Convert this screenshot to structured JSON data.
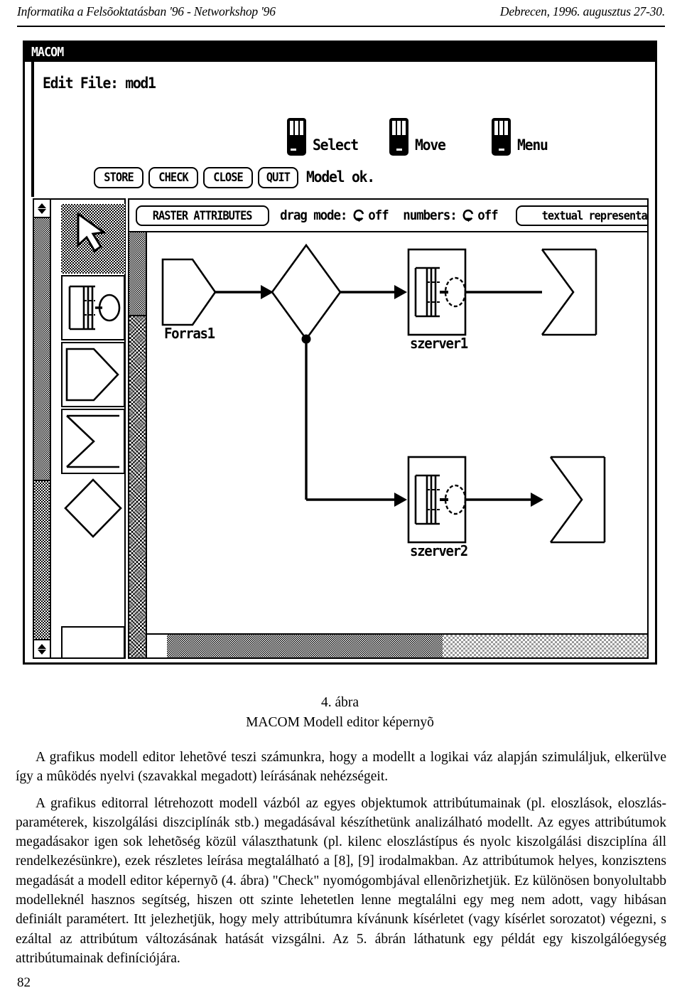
{
  "running_head": {
    "left": "Informatika a Felsõoktatásban '96 - Networkshop '96",
    "right": "Debrecen, 1996. augusztus 27-30."
  },
  "screenshot": {
    "window_title": "MACOM",
    "edit_file_line": "Edit File: mod1",
    "mouse_legend": [
      {
        "label": "Select",
        "icon": "mouse-left-button-icon",
        "active_button": 0
      },
      {
        "label": "Move",
        "icon": "mouse-middle-button-icon",
        "active_button": 1
      },
      {
        "label": "Menu",
        "icon": "mouse-right-button-icon",
        "active_button": 2
      }
    ],
    "action_buttons": [
      {
        "label": "STORE"
      },
      {
        "label": "CHECK"
      },
      {
        "label": "CLOSE"
      },
      {
        "label": "QUIT"
      }
    ],
    "status_text": "Model ok.",
    "toolbar": {
      "raster_attributes_label": "RASTER ATTRIBUTES",
      "drag_mode_label": "drag mode:",
      "drag_mode_value": "off",
      "numbers_label": "numbers:",
      "numbers_value": "off",
      "textual_representation_label": "textual representat"
    },
    "palette": {
      "items": [
        {
          "name": "arrow-cursor-tool",
          "selected": true
        },
        {
          "name": "server-tool",
          "selected": false
        },
        {
          "name": "source-pentagon-tool",
          "selected": false
        },
        {
          "name": "sink-chevron-tool",
          "selected": false
        },
        {
          "name": "router-diamond-tool",
          "selected": false
        },
        {
          "name": "rectangle-tool",
          "selected": false
        }
      ]
    },
    "diagram": {
      "nodes": [
        {
          "id": "forras1",
          "type": "source",
          "label": "Forras1"
        },
        {
          "id": "router1",
          "type": "diamond",
          "label": ""
        },
        {
          "id": "szerver1",
          "type": "server",
          "label": "szerver1"
        },
        {
          "id": "sink1",
          "type": "chevron",
          "label": ""
        },
        {
          "id": "szerver2",
          "type": "server",
          "label": "szerver2"
        },
        {
          "id": "sink2",
          "type": "chevron",
          "label": ""
        }
      ]
    }
  },
  "caption": {
    "figure_number": "4. ábra",
    "figure_title": "MACOM Modell editor képernyõ"
  },
  "body": {
    "paragraphs": [
      "A grafikus modell editor lehetõvé teszi számunkra, hogy a modellt a logikai váz alapján szimuláljuk, elkerülve így a mûködés nyelvi (szavakkal megadott) leírásának nehézségeit.",
      "A grafikus editorral létrehozott modell vázból az egyes objektumok attribútumainak (pl. eloszlások, eloszlás-paraméterek, kiszolgálási diszciplínák stb.) megadásával készíthetünk analizálható modellt. Az egyes attribútumok megadásakor igen sok lehetõség közül választhatunk (pl. kilenc eloszlástípus és nyolc kiszolgálási diszciplína áll rendelkezésünkre), ezek részletes leírása megtalálható a [8], [9] irodalmakban. Az attribútumok helyes, konzisztens megadását  a modell editor képernyõ (4. ábra) \"Check\" nyomógombjával ellenõrizhetjük. Ez különösen bonyolultabb modelleknél hasznos segítség, hiszen ott szinte lehetetlen lenne megtalálni egy meg nem adott, vagy hibásan definiált paramétert. Itt jelezhetjük, hogy mely attribútumra kívánunk kísérletet (vagy kísérlet sorozatot) végezni, s ezáltal az attribútum változásának hatását vizsgálni. Az 5. ábrán láthatunk egy példát egy kiszolgálóegység attribútumainak definíciójára."
    ]
  },
  "page_number": "82"
}
